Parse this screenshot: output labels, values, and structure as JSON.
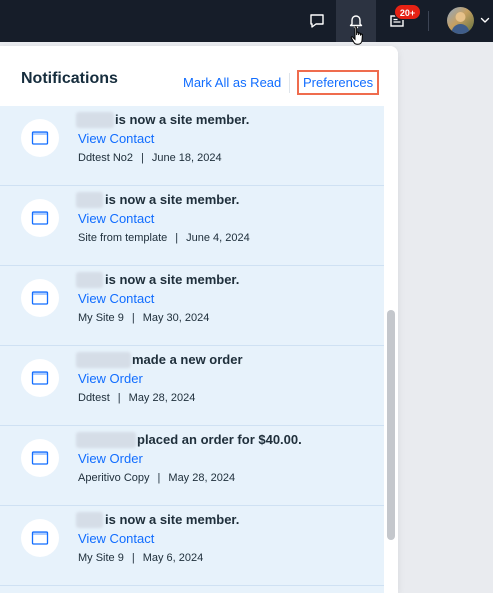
{
  "topbar": {
    "icons": [
      "chat-icon",
      "bell-icon",
      "inbox-icon"
    ],
    "badge": "20+",
    "avatar": "user-avatar"
  },
  "panel": {
    "title": "Notifications",
    "mark_all_label": "Mark All as Read",
    "preferences_label": "Preferences"
  },
  "notifications": [
    {
      "text": "is now a site member.",
      "link": "View Contact",
      "site": "Ddtest No2",
      "date": "June 18, 2024"
    },
    {
      "text": "is now a site member.",
      "link": "View Contact",
      "site": "Site from template",
      "date": "June 4, 2024"
    },
    {
      "text": "is now a site member.",
      "link": "View Contact",
      "site": "My Site 9",
      "date": "May 30, 2024"
    },
    {
      "text": "made a new order",
      "link": "View Order",
      "site": "Ddtest",
      "date": "May 28, 2024"
    },
    {
      "text": "placed an order for $40.00.",
      "link": "View Order",
      "site": "Aperitivo Copy",
      "date": "May 28, 2024"
    },
    {
      "text": "is now a site member.",
      "link": "View Contact",
      "site": "My Site 9",
      "date": "May 6, 2024"
    }
  ],
  "colors": {
    "accent": "#116dff",
    "badge": "#e62214",
    "topbar": "#161d29",
    "highlight": "#ef6c4e",
    "row_bg": "#e7f2fb"
  }
}
